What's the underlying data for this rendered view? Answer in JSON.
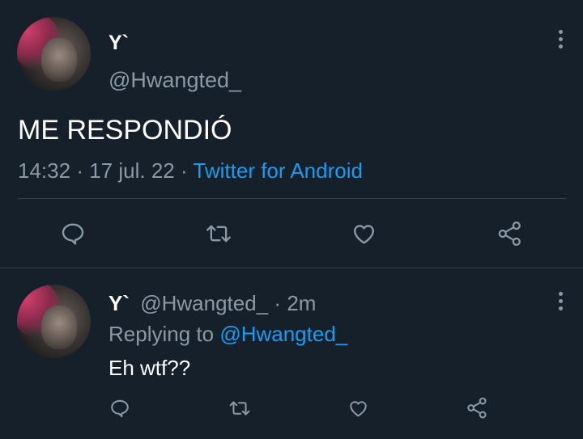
{
  "main_tweet": {
    "display_name": "Y`",
    "handle": "@Hwangted_",
    "text": "ME RESPONDIÓ",
    "time": "14:32",
    "separator": "·",
    "date": "17 jul. 22",
    "source": "Twitter for Android"
  },
  "reply_tweet": {
    "display_name": "Y`",
    "handle": "@Hwangted_",
    "separator": "·",
    "age": "2m",
    "replying_label": "Replying to",
    "replying_handle": "@Hwangted_",
    "text": "Eh wtf??"
  },
  "icons": [
    "avatar",
    "more-vertical-icon",
    "reply-icon",
    "retweet-icon",
    "like-icon",
    "share-icon"
  ],
  "colors": {
    "background": "#15202b",
    "text": "#ffffff",
    "secondary": "#8b98a5",
    "link": "#1d9bf0",
    "divider": "#38444d"
  }
}
